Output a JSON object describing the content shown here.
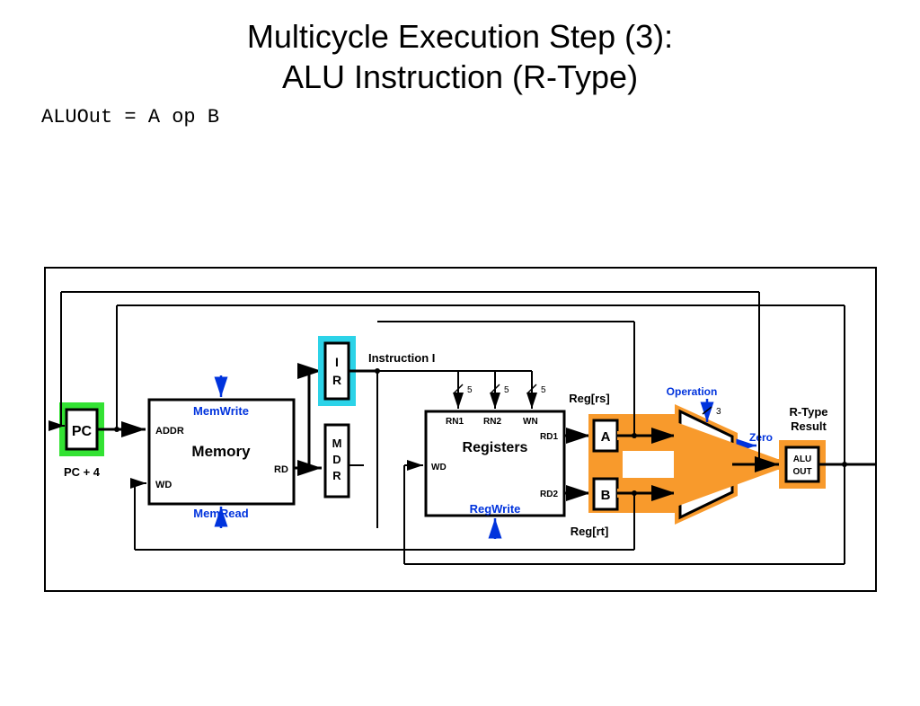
{
  "title_line1": "Multicycle Execution Step (3):",
  "title_line2": "ALU Instruction (R-Type)",
  "code": "ALUOut = A op B",
  "boxes": {
    "pc": "PC",
    "memory": "Memory",
    "ir1": "I",
    "ir2": "R",
    "mdr1": "M",
    "mdr2": "D",
    "mdr3": "R",
    "registers": "Registers",
    "a": "A",
    "b": "B",
    "alu": "ALU",
    "aluout1": "ALU",
    "aluout2": "OUT"
  },
  "labels": {
    "pc_plus_4": "PC + 4",
    "memwrite": "MemWrite",
    "memread": "MemRead",
    "addr": "ADDR",
    "wd": "WD",
    "rd": "RD",
    "instruction_i": "Instruction I",
    "rn1": "RN1",
    "rn2": "RN2",
    "wn": "WN",
    "wd2": "WD",
    "rd1": "RD1",
    "rd2": "RD2",
    "regwrite": "RegWrite",
    "reg_rs": "Reg[rs]",
    "reg_rt": "Reg[rt]",
    "operation": "Operation",
    "zero": "Zero",
    "rtype1": "R-Type",
    "rtype2": "Result",
    "five": "5",
    "three": "3"
  },
  "colors": {
    "highlight_orange": "#F89A2C",
    "highlight_green": "#33E233",
    "highlight_cyan": "#2CD3E8",
    "signal_blue": "#0033DD",
    "black": "#000000"
  }
}
